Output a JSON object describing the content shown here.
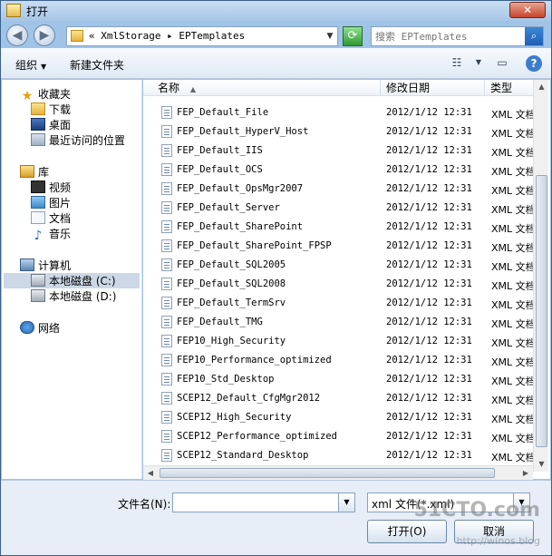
{
  "window": {
    "title": "打开",
    "close_label": "✕"
  },
  "address": {
    "breadcrumb": "« XmlStorage ▸ EPTemplates"
  },
  "search": {
    "placeholder": "搜索 EPTemplates"
  },
  "toolbar": {
    "organize": "组织",
    "new_folder": "新建文件夹"
  },
  "nav": {
    "favorites_header": "收藏夹",
    "favorites": [
      "下载",
      "桌面",
      "最近访问的位置"
    ],
    "libraries_header": "库",
    "libraries": [
      "视频",
      "图片",
      "文档",
      "音乐"
    ],
    "computer_header": "计算机",
    "drives": [
      "本地磁盘 (C:)",
      "本地磁盘 (D:)"
    ],
    "network": "网络"
  },
  "columns": {
    "name": "名称",
    "date": "修改日期",
    "type": "类型"
  },
  "files": [
    {
      "name": "FEP_Default_File",
      "date": "2012/1/12 12:31",
      "type": "XML 文档"
    },
    {
      "name": "FEP_Default_HyperV_Host",
      "date": "2012/1/12 12:31",
      "type": "XML 文档"
    },
    {
      "name": "FEP_Default_IIS",
      "date": "2012/1/12 12:31",
      "type": "XML 文档"
    },
    {
      "name": "FEP_Default_OCS",
      "date": "2012/1/12 12:31",
      "type": "XML 文档"
    },
    {
      "name": "FEP_Default_OpsMgr2007",
      "date": "2012/1/12 12:31",
      "type": "XML 文档"
    },
    {
      "name": "FEP_Default_Server",
      "date": "2012/1/12 12:31",
      "type": "XML 文档"
    },
    {
      "name": "FEP_Default_SharePoint",
      "date": "2012/1/12 12:31",
      "type": "XML 文档"
    },
    {
      "name": "FEP_Default_SharePoint_FPSP",
      "date": "2012/1/12 12:31",
      "type": "XML 文档"
    },
    {
      "name": "FEP_Default_SQL2005",
      "date": "2012/1/12 12:31",
      "type": "XML 文档"
    },
    {
      "name": "FEP_Default_SQL2008",
      "date": "2012/1/12 12:31",
      "type": "XML 文档"
    },
    {
      "name": "FEP_Default_TermSrv",
      "date": "2012/1/12 12:31",
      "type": "XML 文档"
    },
    {
      "name": "FEP_Default_TMG",
      "date": "2012/1/12 12:31",
      "type": "XML 文档"
    },
    {
      "name": "FEP10_High_Security",
      "date": "2012/1/12 12:31",
      "type": "XML 文档"
    },
    {
      "name": "FEP10_Performance_optimized",
      "date": "2012/1/12 12:31",
      "type": "XML 文档"
    },
    {
      "name": "FEP10_Std_Desktop",
      "date": "2012/1/12 12:31",
      "type": "XML 文档"
    },
    {
      "name": "SCEP12_Default_CfgMgr2012",
      "date": "2012/1/12 12:31",
      "type": "XML 文档"
    },
    {
      "name": "SCEP12_High_Security",
      "date": "2012/1/12 12:31",
      "type": "XML 文档"
    },
    {
      "name": "SCEP12_Performance_optimized",
      "date": "2012/1/12 12:31",
      "type": "XML 文档"
    },
    {
      "name": "SCEP12_Standard_Desktop",
      "date": "2012/1/12 12:31",
      "type": "XML 文档"
    }
  ],
  "bottom": {
    "filename_label": "文件名(N):",
    "filename_value": "",
    "filter_value": "xml 文件(*.xml)",
    "open_label": "打开(O)",
    "cancel_label": "取消"
  },
  "watermark": {
    "main": "51CTO.com",
    "sub": "http://winos.blog"
  }
}
